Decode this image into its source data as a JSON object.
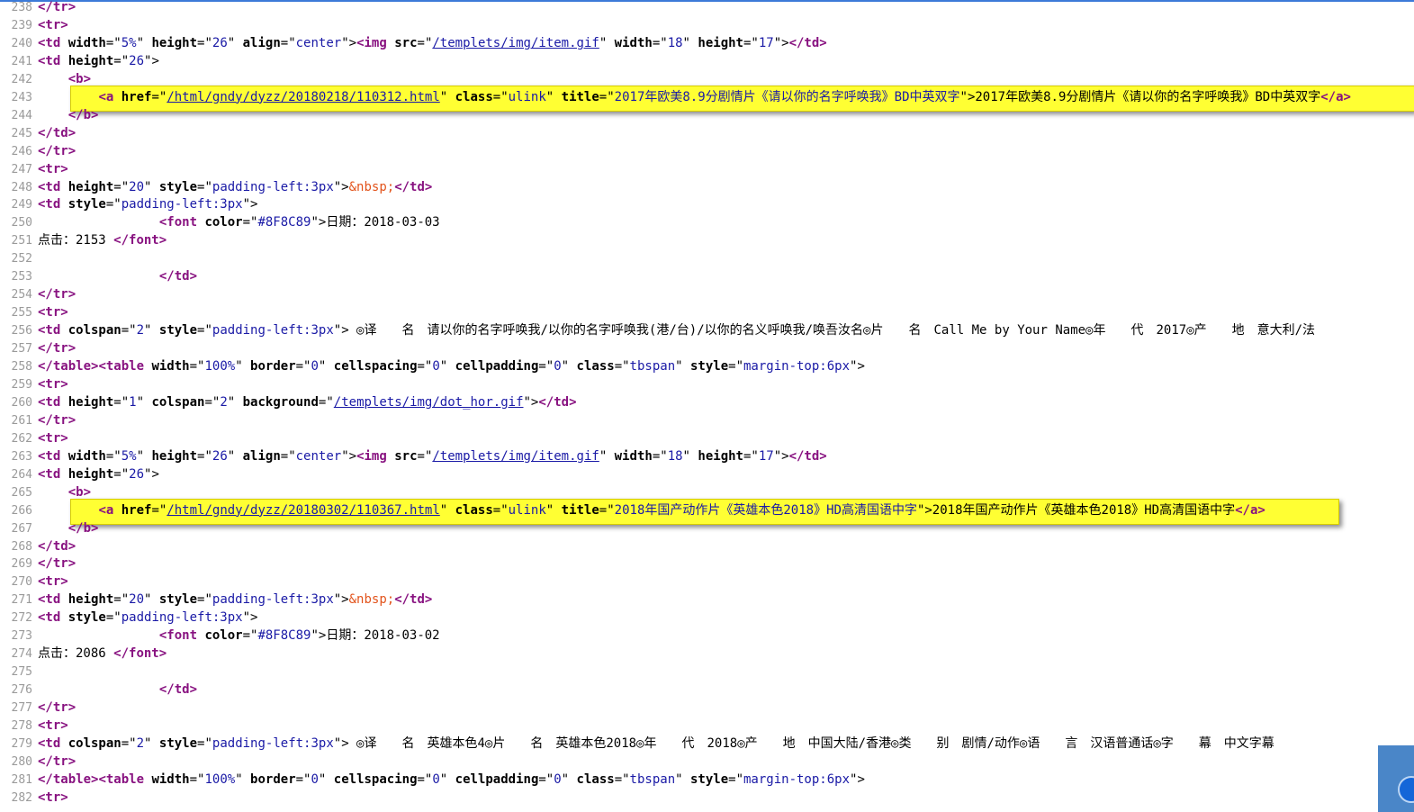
{
  "viewer": {
    "lines": [
      {
        "n": "238",
        "s": [
          [
            "t",
            "</tr>"
          ]
        ]
      },
      {
        "n": "239",
        "s": [
          [
            "t",
            "<tr>"
          ]
        ]
      },
      {
        "n": "240",
        "s": [
          [
            "t",
            "<td "
          ],
          [
            "an",
            "width"
          ],
          [
            "c",
            "=\""
          ],
          [
            "av",
            "5%"
          ],
          [
            "c",
            "\" "
          ],
          [
            "an",
            "height"
          ],
          [
            "c",
            "=\""
          ],
          [
            "av",
            "26"
          ],
          [
            "c",
            "\" "
          ],
          [
            "an",
            "align"
          ],
          [
            "c",
            "=\""
          ],
          [
            "av",
            "center"
          ],
          [
            "c",
            "\">"
          ],
          [
            "t",
            "<img "
          ],
          [
            "an",
            "src"
          ],
          [
            "c",
            "=\""
          ],
          [
            "lk",
            "/templets/img/item.gif"
          ],
          [
            "c",
            "\" "
          ],
          [
            "an",
            "width"
          ],
          [
            "c",
            "=\""
          ],
          [
            "av",
            "18"
          ],
          [
            "c",
            "\" "
          ],
          [
            "an",
            "height"
          ],
          [
            "c",
            "=\""
          ],
          [
            "av",
            "17"
          ],
          [
            "c",
            "\">"
          ],
          [
            "t",
            "</td>"
          ]
        ]
      },
      {
        "n": "241",
        "s": [
          [
            "t",
            "<td "
          ],
          [
            "an",
            "height"
          ],
          [
            "c",
            "=\""
          ],
          [
            "av",
            "26"
          ],
          [
            "c",
            "\">"
          ]
        ]
      },
      {
        "n": "242",
        "s": [
          [
            "c",
            "    "
          ],
          [
            "t",
            "<b>"
          ]
        ]
      },
      {
        "n": "243",
        "hl": 1,
        "s": [
          [
            "c",
            "        "
          ],
          [
            "t",
            "<a "
          ],
          [
            "an",
            "href"
          ],
          [
            "c",
            "=\""
          ],
          [
            "lk",
            "/html/gndy/dyzz/20180218/110312.html"
          ],
          [
            "c",
            "\" "
          ],
          [
            "an",
            "class"
          ],
          [
            "c",
            "=\""
          ],
          [
            "av",
            "ulink"
          ],
          [
            "c",
            "\" "
          ],
          [
            "an",
            "title"
          ],
          [
            "c",
            "=\""
          ],
          [
            "av",
            "2017年欧美8.9分剧情片《请以你的名字呼唤我》BD中英双字"
          ],
          [
            "c",
            "\">2017年欧美8.9分剧情片《请以你的名字呼唤我》BD中英双字"
          ],
          [
            "t",
            "</a>"
          ]
        ]
      },
      {
        "n": "244",
        "s": [
          [
            "c",
            "    "
          ],
          [
            "t",
            "</b>"
          ]
        ]
      },
      {
        "n": "245",
        "s": [
          [
            "t",
            "</td>"
          ]
        ]
      },
      {
        "n": "246",
        "s": [
          [
            "t",
            "</tr>"
          ]
        ]
      },
      {
        "n": "247",
        "s": [
          [
            "t",
            "<tr>"
          ]
        ]
      },
      {
        "n": "248",
        "s": [
          [
            "t",
            "<td "
          ],
          [
            "an",
            "height"
          ],
          [
            "c",
            "=\""
          ],
          [
            "av",
            "20"
          ],
          [
            "c",
            "\" "
          ],
          [
            "an",
            "style"
          ],
          [
            "c",
            "=\""
          ],
          [
            "av",
            "padding-left:3px"
          ],
          [
            "c",
            "\">"
          ],
          [
            "en",
            "&nbsp;"
          ],
          [
            "t",
            "</td>"
          ]
        ]
      },
      {
        "n": "249",
        "s": [
          [
            "t",
            "<td "
          ],
          [
            "an",
            "style"
          ],
          [
            "c",
            "=\""
          ],
          [
            "av",
            "padding-left:3px"
          ],
          [
            "c",
            "\">"
          ]
        ]
      },
      {
        "n": "250",
        "s": [
          [
            "c",
            "                "
          ],
          [
            "t",
            "<font "
          ],
          [
            "an",
            "color"
          ],
          [
            "c",
            "=\""
          ],
          [
            "av",
            "#8F8C89"
          ],
          [
            "c",
            "\">日期：2018-03-03"
          ]
        ]
      },
      {
        "n": "251",
        "s": [
          [
            "c",
            "点击：2153 "
          ],
          [
            "t",
            "</font>"
          ]
        ]
      },
      {
        "n": "252",
        "s": []
      },
      {
        "n": "253",
        "s": [
          [
            "c",
            "                "
          ],
          [
            "t",
            "</td>"
          ]
        ]
      },
      {
        "n": "254",
        "s": [
          [
            "t",
            "</tr>"
          ]
        ]
      },
      {
        "n": "255",
        "s": [
          [
            "t",
            "<tr>"
          ]
        ]
      },
      {
        "n": "256",
        "s": [
          [
            "t",
            "<td "
          ],
          [
            "an",
            "colspan"
          ],
          [
            "c",
            "=\""
          ],
          [
            "av",
            "2"
          ],
          [
            "c",
            "\" "
          ],
          [
            "an",
            "style"
          ],
          [
            "c",
            "=\""
          ],
          [
            "av",
            "padding-left:3px"
          ],
          [
            "c",
            "\"> ◎译　　名　请以你的名字呼唤我/以你的名字呼唤我(港/台)/以你的名义呼唤我/唤吾汝名◎片　　名　Call Me by Your Name◎年　　代　2017◎产　　地　意大利/法"
          ]
        ]
      },
      {
        "n": "257",
        "s": [
          [
            "t",
            "</tr>"
          ]
        ]
      },
      {
        "n": "258",
        "s": [
          [
            "t",
            "</table>"
          ],
          [
            "t",
            "<table "
          ],
          [
            "an",
            "width"
          ],
          [
            "c",
            "=\""
          ],
          [
            "av",
            "100%"
          ],
          [
            "c",
            "\" "
          ],
          [
            "an",
            "border"
          ],
          [
            "c",
            "=\""
          ],
          [
            "av",
            "0"
          ],
          [
            "c",
            "\" "
          ],
          [
            "an",
            "cellspacing"
          ],
          [
            "c",
            "=\""
          ],
          [
            "av",
            "0"
          ],
          [
            "c",
            "\" "
          ],
          [
            "an",
            "cellpadding"
          ],
          [
            "c",
            "=\""
          ],
          [
            "av",
            "0"
          ],
          [
            "c",
            "\" "
          ],
          [
            "an",
            "class"
          ],
          [
            "c",
            "=\""
          ],
          [
            "av",
            "tbspan"
          ],
          [
            "c",
            "\" "
          ],
          [
            "an",
            "style"
          ],
          [
            "c",
            "=\""
          ],
          [
            "av",
            "margin-top:6px"
          ],
          [
            "c",
            "\">"
          ]
        ]
      },
      {
        "n": "259",
        "s": [
          [
            "t",
            "<tr>"
          ]
        ]
      },
      {
        "n": "260",
        "s": [
          [
            "t",
            "<td "
          ],
          [
            "an",
            "height"
          ],
          [
            "c",
            "=\""
          ],
          [
            "av",
            "1"
          ],
          [
            "c",
            "\" "
          ],
          [
            "an",
            "colspan"
          ],
          [
            "c",
            "=\""
          ],
          [
            "av",
            "2"
          ],
          [
            "c",
            "\" "
          ],
          [
            "an",
            "background"
          ],
          [
            "c",
            "=\""
          ],
          [
            "lk",
            "/templets/img/dot_hor.gif"
          ],
          [
            "c",
            "\">"
          ],
          [
            "t",
            "</td>"
          ]
        ]
      },
      {
        "n": "261",
        "s": [
          [
            "t",
            "</tr>"
          ]
        ]
      },
      {
        "n": "262",
        "s": [
          [
            "t",
            "<tr>"
          ]
        ]
      },
      {
        "n": "263",
        "s": [
          [
            "t",
            "<td "
          ],
          [
            "an",
            "width"
          ],
          [
            "c",
            "=\""
          ],
          [
            "av",
            "5%"
          ],
          [
            "c",
            "\" "
          ],
          [
            "an",
            "height"
          ],
          [
            "c",
            "=\""
          ],
          [
            "av",
            "26"
          ],
          [
            "c",
            "\" "
          ],
          [
            "an",
            "align"
          ],
          [
            "c",
            "=\""
          ],
          [
            "av",
            "center"
          ],
          [
            "c",
            "\">"
          ],
          [
            "t",
            "<img "
          ],
          [
            "an",
            "src"
          ],
          [
            "c",
            "=\""
          ],
          [
            "lk",
            "/templets/img/item.gif"
          ],
          [
            "c",
            "\" "
          ],
          [
            "an",
            "width"
          ],
          [
            "c",
            "=\""
          ],
          [
            "av",
            "18"
          ],
          [
            "c",
            "\" "
          ],
          [
            "an",
            "height"
          ],
          [
            "c",
            "=\""
          ],
          [
            "av",
            "17"
          ],
          [
            "c",
            "\">"
          ],
          [
            "t",
            "</td>"
          ]
        ]
      },
      {
        "n": "264",
        "s": [
          [
            "t",
            "<td "
          ],
          [
            "an",
            "height"
          ],
          [
            "c",
            "=\""
          ],
          [
            "av",
            "26"
          ],
          [
            "c",
            "\">"
          ]
        ]
      },
      {
        "n": "265",
        "s": [
          [
            "c",
            "    "
          ],
          [
            "t",
            "<b>"
          ]
        ]
      },
      {
        "n": "266",
        "hl": 2,
        "s": [
          [
            "c",
            "        "
          ],
          [
            "t",
            "<a "
          ],
          [
            "an",
            "href"
          ],
          [
            "c",
            "=\""
          ],
          [
            "lk",
            "/html/gndy/dyzz/20180302/110367.html"
          ],
          [
            "c",
            "\" "
          ],
          [
            "an",
            "class"
          ],
          [
            "c",
            "=\""
          ],
          [
            "av",
            "ulink"
          ],
          [
            "c",
            "\" "
          ],
          [
            "an",
            "title"
          ],
          [
            "c",
            "=\""
          ],
          [
            "av",
            "2018年国产动作片《英雄本色2018》HD高清国语中字"
          ],
          [
            "c",
            "\">2018年国产动作片《英雄本色2018》HD高清国语中字"
          ],
          [
            "t",
            "</a>"
          ]
        ]
      },
      {
        "n": "267",
        "s": [
          [
            "c",
            "    "
          ],
          [
            "t",
            "</b>"
          ]
        ]
      },
      {
        "n": "268",
        "s": [
          [
            "t",
            "</td>"
          ]
        ]
      },
      {
        "n": "269",
        "s": [
          [
            "t",
            "</tr>"
          ]
        ]
      },
      {
        "n": "270",
        "s": [
          [
            "t",
            "<tr>"
          ]
        ]
      },
      {
        "n": "271",
        "s": [
          [
            "t",
            "<td "
          ],
          [
            "an",
            "height"
          ],
          [
            "c",
            "=\""
          ],
          [
            "av",
            "20"
          ],
          [
            "c",
            "\" "
          ],
          [
            "an",
            "style"
          ],
          [
            "c",
            "=\""
          ],
          [
            "av",
            "padding-left:3px"
          ],
          [
            "c",
            "\">"
          ],
          [
            "en",
            "&nbsp;"
          ],
          [
            "t",
            "</td>"
          ]
        ]
      },
      {
        "n": "272",
        "s": [
          [
            "t",
            "<td "
          ],
          [
            "an",
            "style"
          ],
          [
            "c",
            "=\""
          ],
          [
            "av",
            "padding-left:3px"
          ],
          [
            "c",
            "\">"
          ]
        ]
      },
      {
        "n": "273",
        "s": [
          [
            "c",
            "                "
          ],
          [
            "t",
            "<font "
          ],
          [
            "an",
            "color"
          ],
          [
            "c",
            "=\""
          ],
          [
            "av",
            "#8F8C89"
          ],
          [
            "c",
            "\">日期：2018-03-02"
          ]
        ]
      },
      {
        "n": "274",
        "s": [
          [
            "c",
            "点击：2086 "
          ],
          [
            "t",
            "</font>"
          ]
        ]
      },
      {
        "n": "275",
        "s": []
      },
      {
        "n": "276",
        "s": [
          [
            "c",
            "                "
          ],
          [
            "t",
            "</td>"
          ]
        ]
      },
      {
        "n": "277",
        "s": [
          [
            "t",
            "</tr>"
          ]
        ]
      },
      {
        "n": "278",
        "s": [
          [
            "t",
            "<tr>"
          ]
        ]
      },
      {
        "n": "279",
        "s": [
          [
            "t",
            "<td "
          ],
          [
            "an",
            "colspan"
          ],
          [
            "c",
            "=\""
          ],
          [
            "av",
            "2"
          ],
          [
            "c",
            "\" "
          ],
          [
            "an",
            "style"
          ],
          [
            "c",
            "=\""
          ],
          [
            "av",
            "padding-left:3px"
          ],
          [
            "c",
            "\"> ◎译　　名　英雄本色4◎片　　名　英雄本色2018◎年　　代　2018◎产　　地　中国大陆/香港◎类　　别　剧情/动作◎语　　言　汉语普通话◎字　　幕　中文字幕"
          ]
        ]
      },
      {
        "n": "280",
        "s": [
          [
            "t",
            "</tr>"
          ]
        ]
      },
      {
        "n": "281",
        "s": [
          [
            "t",
            "</table>"
          ],
          [
            "t",
            "<table "
          ],
          [
            "an",
            "width"
          ],
          [
            "c",
            "=\""
          ],
          [
            "av",
            "100%"
          ],
          [
            "c",
            "\" "
          ],
          [
            "an",
            "border"
          ],
          [
            "c",
            "=\""
          ],
          [
            "av",
            "0"
          ],
          [
            "c",
            "\" "
          ],
          [
            "an",
            "cellspacing"
          ],
          [
            "c",
            "=\""
          ],
          [
            "av",
            "0"
          ],
          [
            "c",
            "\" "
          ],
          [
            "an",
            "cellpadding"
          ],
          [
            "c",
            "=\""
          ],
          [
            "av",
            "0"
          ],
          [
            "c",
            "\" "
          ],
          [
            "an",
            "class"
          ],
          [
            "c",
            "=\""
          ],
          [
            "av",
            "tbspan"
          ],
          [
            "c",
            "\" "
          ],
          [
            "an",
            "style"
          ],
          [
            "c",
            "=\""
          ],
          [
            "av",
            "margin-top:6px"
          ],
          [
            "c",
            "\">"
          ]
        ]
      },
      {
        "n": "282",
        "s": [
          [
            "t",
            "<tr>"
          ]
        ]
      }
    ]
  },
  "colors": {
    "tag": "#881280",
    "attr_value": "#1a1aa6",
    "entity": "#e2531b",
    "line_number": "#9a9a9a",
    "highlight": "#ffff33"
  }
}
